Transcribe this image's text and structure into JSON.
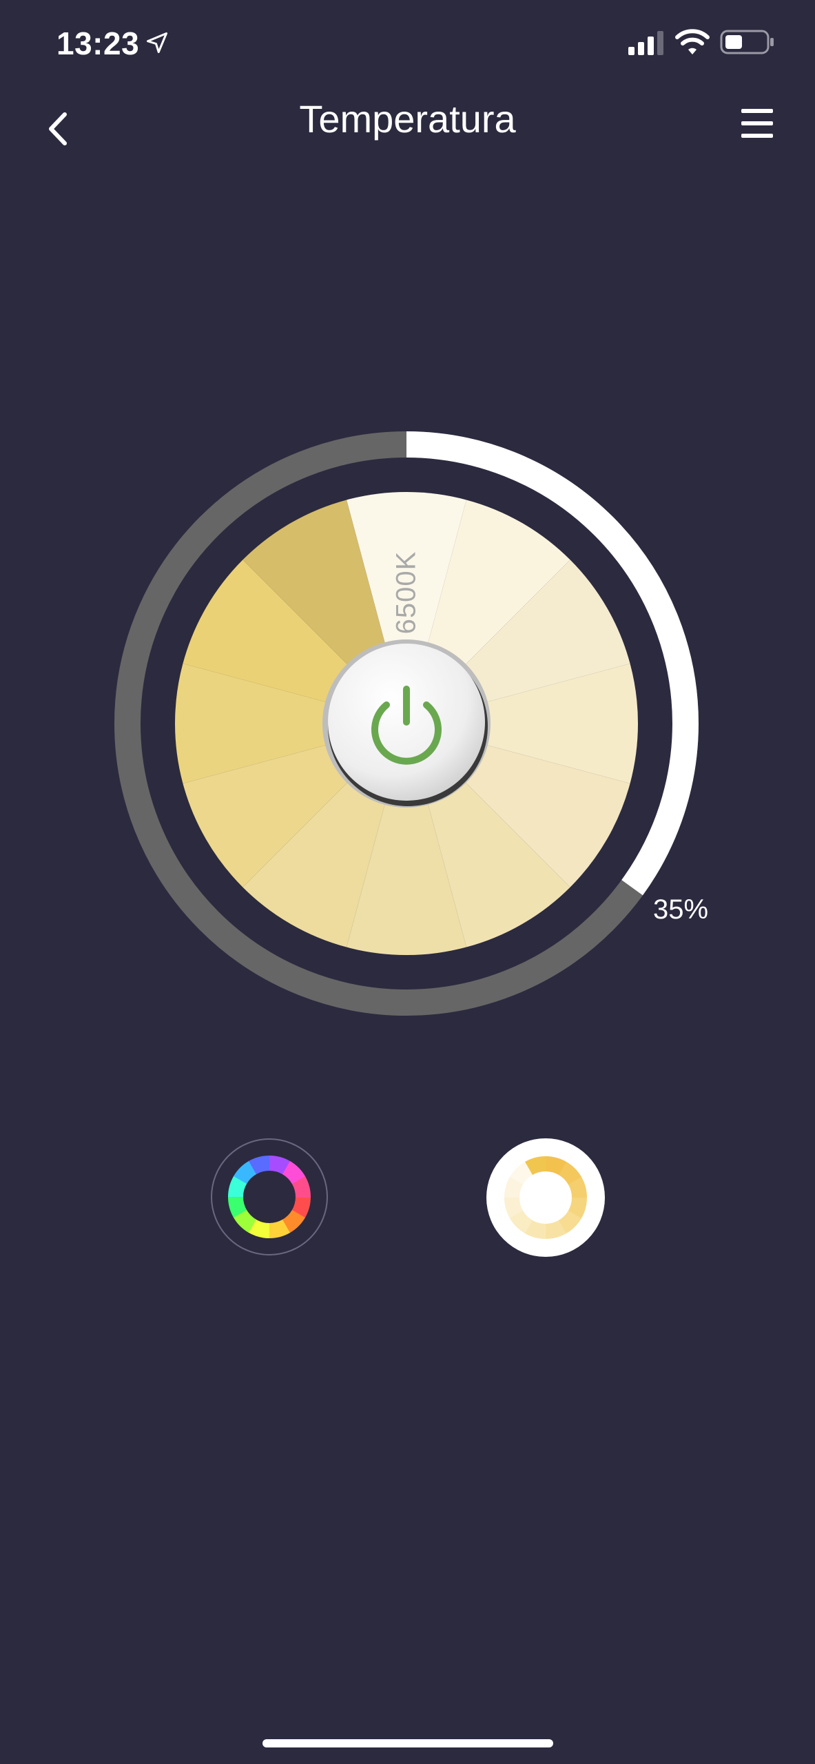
{
  "status_bar": {
    "time": "13:23",
    "icons": [
      "location-arrow-icon",
      "cellular-signal-icon",
      "wifi-icon",
      "battery-icon"
    ]
  },
  "header": {
    "title": "Temperatura",
    "back_icon": "chevron-left-icon",
    "menu_icon": "hamburger-menu-icon"
  },
  "dial": {
    "temperature_label": "6500K",
    "brightness_label": "35%",
    "brightness_level": 0.35,
    "power_icon": "power-icon",
    "colors": {
      "ring_track": "#666666",
      "ring_fill": "#ffffff",
      "power_symbol": "#6aa84f"
    }
  },
  "modes": {
    "color_mode_icon": "color-wheel-icon",
    "white_mode_icon": "temperature-wheel-icon",
    "selected": "white"
  },
  "colors": {
    "background": "#2c2a3f",
    "accent": "#f2c14e"
  }
}
